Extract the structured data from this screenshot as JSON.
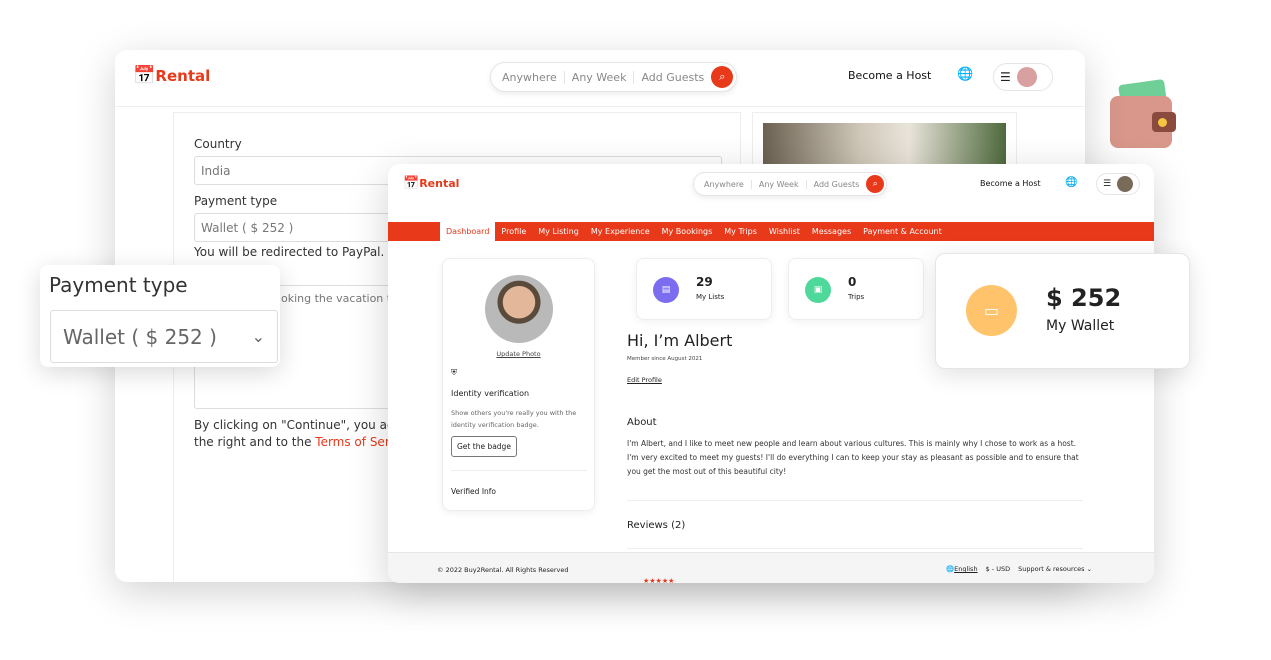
{
  "brand": {
    "name": "Rental",
    "color": "#e8391a"
  },
  "search": {
    "where": "Anywhere",
    "week": "Any Week",
    "guests": "Add Guests"
  },
  "header": {
    "become_host": "Become a Host"
  },
  "checkout": {
    "country_label": "Country",
    "country_value": "India",
    "payment_label": "Payment type",
    "payment_value": "Wallet ( $ 252 )",
    "redirect_note": "You will be redirected to PayPal.",
    "message_partial": "oking the vacation trip",
    "terms_line1": "By clicking on \"Continue\", you agree to",
    "terms_line2": "the right and to the ",
    "terms_link": "Terms of Service",
    " terms_end": " ."
  },
  "popup": {
    "label": "Payment type",
    "value": "Wallet ( $ 252 )"
  },
  "nav": [
    "Dashboard",
    "Profile",
    "My Listing",
    "My Experience",
    "My Bookings",
    "My Trips",
    "Wishlist",
    "Messages",
    "Payment & Account"
  ],
  "profile": {
    "update_photo": "Update Photo",
    "identity_title": "Identity verification",
    "identity_desc": "Show others you're really you with the identity verification badge.",
    "badge_button": "Get the badge",
    "verified_info": "Verified Info"
  },
  "stats": [
    {
      "value": "29",
      "label": "My Lists",
      "color": "#7b6cf0"
    },
    {
      "value": "0",
      "label": "Trips",
      "color": "#4ed89a"
    }
  ],
  "wallet": {
    "amount": "$ 252",
    "label": "My Wallet",
    "color": "#ffc46b"
  },
  "greeting": {
    "title": "Hi, I’m Albert",
    "member_since": "Member since August 2021",
    "edit": "Edit Profile"
  },
  "about": {
    "title": "About",
    "text": "I'm Albert, and I like to meet new people and learn about various cultures. This is mainly why I chose to work as a host. I'm very excited to meet my guests! I'll do everything I can to keep your stay as pleasant as possible and to ensure that you get the most out of this beautiful city!"
  },
  "reviews": {
    "title": "Reviews (2)",
    "stars": "★★★★★"
  },
  "footer": {
    "copyright": "© 2022 Buy2Rental. All Rights Reserved",
    "language": "English",
    "currency": "$ - USD",
    "support": "Support & resources"
  }
}
